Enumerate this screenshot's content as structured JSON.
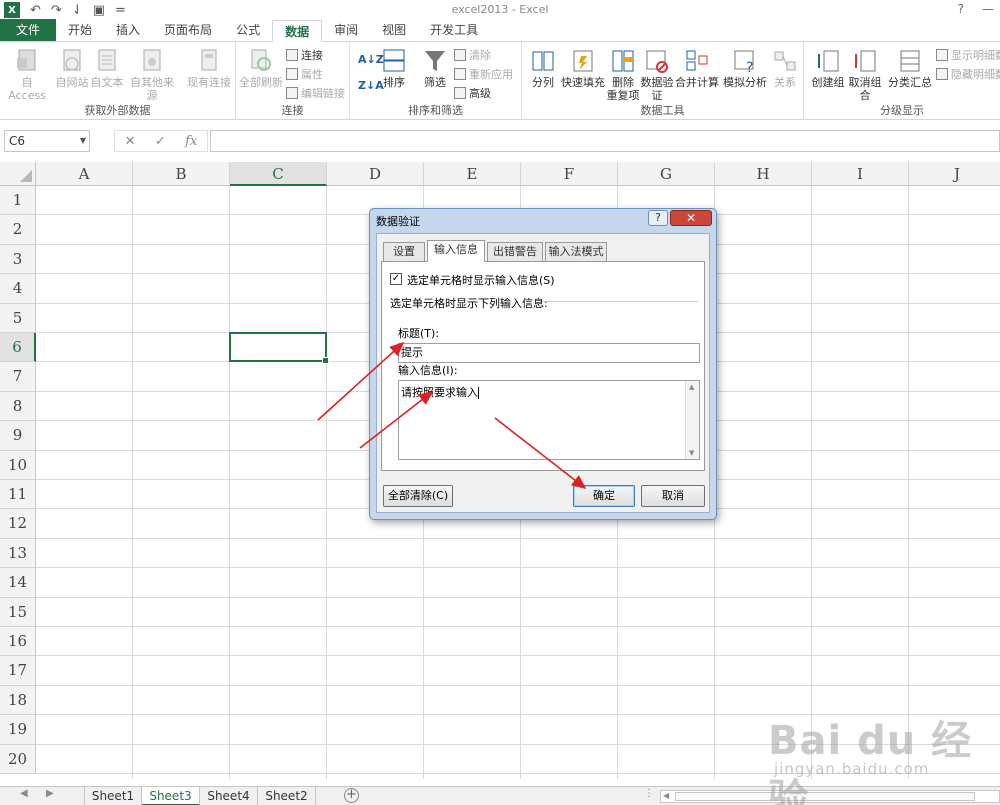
{
  "window": {
    "title": "excel2013 - Excel",
    "help": "?",
    "minimize": "—"
  },
  "qat": {
    "logo": "X",
    "undo": "↶",
    "redo": "↷",
    "touch": "⇃",
    "save": "▣",
    "more": "="
  },
  "tabs": [
    "文件",
    "开始",
    "插入",
    "页面布局",
    "公式",
    "数据",
    "审阅",
    "视图",
    "开发工具"
  ],
  "active_tab_index": 5,
  "ribbon": {
    "groups": [
      {
        "label": "获取外部数据",
        "buttons": [
          "自 Access",
          "自网站",
          "自文本",
          "自其他来源",
          "现有连接"
        ]
      },
      {
        "label": "连接",
        "buttons": [
          "全部刷新"
        ],
        "small": [
          "连接",
          "属性",
          "编辑链接"
        ]
      },
      {
        "label": "排序和筛选",
        "buttons": [
          "排序",
          "筛选"
        ],
        "small": [
          "清除",
          "重新应用",
          "高级"
        ]
      },
      {
        "label": "数据工具",
        "buttons": [
          "分列",
          "快速填充",
          "删除\n重复项",
          "数据验\n证",
          "合并计算",
          "模拟分析",
          "关系"
        ]
      },
      {
        "label": "分级显示",
        "buttons": [
          "创建组",
          "取消组合",
          "分类汇总"
        ],
        "small": [
          "显示明细数",
          "隐藏明细数"
        ]
      }
    ]
  },
  "formula_bar": {
    "name_box": "C6",
    "cancel": "✕",
    "enter": "✓",
    "fx": "fx",
    "value": ""
  },
  "grid": {
    "columns": [
      "A",
      "B",
      "C",
      "D",
      "E",
      "F",
      "G",
      "H",
      "I",
      "J"
    ],
    "rows": [
      "1",
      "2",
      "3",
      "4",
      "5",
      "6",
      "7",
      "8",
      "9",
      "10",
      "11",
      "12",
      "13",
      "14",
      "15",
      "16",
      "17",
      "18",
      "19",
      "20"
    ],
    "selected_cell": "C6"
  },
  "sheets": {
    "tabs": [
      "Sheet1",
      "Sheet3",
      "Sheet4",
      "Sheet2"
    ],
    "active": "Sheet3",
    "add": "+"
  },
  "dialog": {
    "title": "数据验证",
    "help_btn": "?",
    "close_btn": "✕",
    "tabs": [
      "设置",
      "输入信息",
      "出错警告",
      "输入法模式"
    ],
    "active_tab": "输入信息",
    "checkbox_label": "选定单元格时显示输入信息(S)",
    "checkbox_checked": true,
    "section_label": "选定单元格时显示下列输入信息:",
    "title_label": "标题(T):",
    "title_value": "提示",
    "message_label": "输入信息(I):",
    "message_value": "请按照要求输入",
    "clear_button": "全部清除(C)",
    "ok_button": "确定",
    "cancel_button": "取消"
  },
  "colors": {
    "accent": "#217346",
    "arrow": "#e02020",
    "dialog_frame": "#c4d7ec"
  },
  "watermark": {
    "logo_text": "Bai du 经验",
    "sub_text": "jingyan.baidu.com"
  }
}
